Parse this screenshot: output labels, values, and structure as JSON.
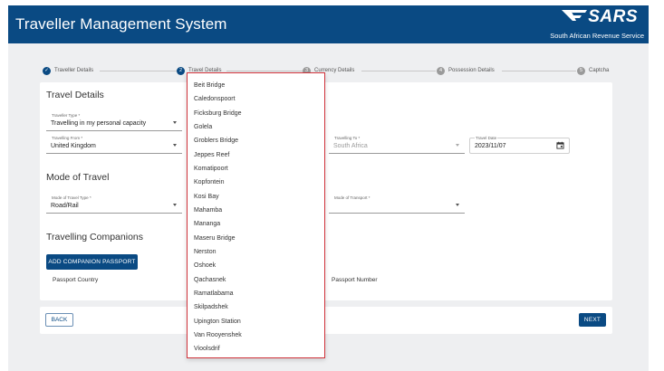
{
  "header": {
    "title": "Traveller Management System",
    "logo_text": "SARS",
    "subtitle": "South African Revenue Service"
  },
  "stepper": {
    "steps": [
      {
        "label": "Traveller Details",
        "marker": "✓",
        "state": "done"
      },
      {
        "label": "Travel Details",
        "marker": "2",
        "state": "active"
      },
      {
        "label": "Currency Details",
        "marker": "3",
        "state": "todo"
      },
      {
        "label": "Possession Details",
        "marker": "4",
        "state": "todo"
      },
      {
        "label": "Captcha",
        "marker": "5",
        "state": "todo"
      }
    ]
  },
  "travel_details": {
    "title": "Travel Details",
    "traveller_type": {
      "label": "Traveller Type *",
      "value": "Travelling in my personal capacity"
    },
    "travelling_from": {
      "label": "Travelling From *",
      "value": "United Kingdom"
    },
    "travelling_to": {
      "label": "Travelling To *",
      "value": "South Africa"
    },
    "travel_date": {
      "label": "Travel Date",
      "value": "2023/11/07"
    }
  },
  "mode_of_travel": {
    "title": "Mode of Travel",
    "mode_of_travel_type": {
      "label": "Mode of Travel Type *",
      "value": "Road/Rail"
    },
    "mode_of_transport": {
      "label": "Mode of Transport *",
      "value": ""
    }
  },
  "companions": {
    "title": "Travelling Companions",
    "add_button": "ADD COMPANION PASSPORT",
    "columns": [
      "Passport Country",
      "Passport Number"
    ]
  },
  "navigation": {
    "back_label": "BACK",
    "next_label": "NEXT"
  },
  "dropdown": {
    "options": [
      "Beit Bridge",
      "Caledonspoort",
      "Ficksburg Bridge",
      "Golela",
      "Groblers Bridge",
      "Jeppes Reef",
      "Komatipoort",
      "Kopfontein",
      "Kosi Bay",
      "Mahamba",
      "Mananga",
      "Maseru Bridge",
      "Nerston",
      "Oshoek",
      "Qachasnek",
      "Ramatlabama",
      "Skilpadshek",
      "Upington Station",
      "Van Rooyenshek",
      "Vioolsdrif"
    ]
  },
  "colors": {
    "brand": "#0a4a83",
    "dropdown_border": "#d0323a",
    "page_background": "#eeeff1"
  }
}
